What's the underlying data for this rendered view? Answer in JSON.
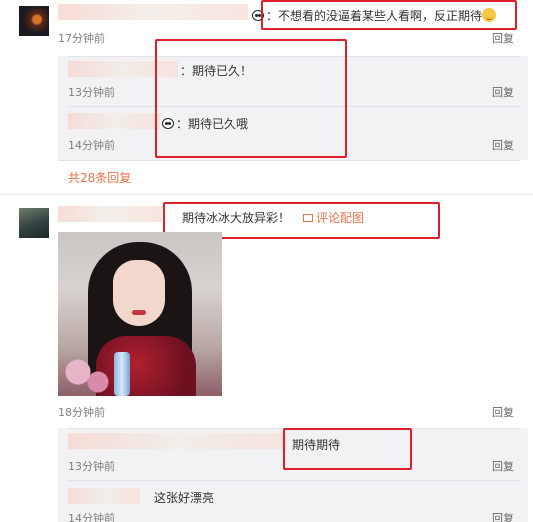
{
  "comments": [
    {
      "text": "：不想看的没逼着某些人看啊，反正期待",
      "time": "17分钟前",
      "reply": "回复",
      "subreplies": [
        {
          "text": "：期待已久！",
          "time": "13分钟前",
          "reply": "回复"
        },
        {
          "text": "：期待已久哦",
          "time": "14分钟前",
          "reply": "回复"
        }
      ],
      "more_replies": "共28条回复"
    },
    {
      "text": "期待冰冰大放异彩！",
      "image_link": "评论配图",
      "time": "18分钟前",
      "reply": "回复",
      "subreplies": [
        {
          "text": "期待期待",
          "time": "13分钟前",
          "reply": "回复"
        },
        {
          "text": "这张好漂亮",
          "time": "14分钟前",
          "reply": "回复"
        }
      ]
    }
  ],
  "colors": {
    "highlight_box": "#e21e2a",
    "link": "#eb7350",
    "subbox_bg": "#f2f2f5"
  },
  "icons": [
    "panda-emoji-icon",
    "smile-emoji-icon",
    "image-icon"
  ]
}
